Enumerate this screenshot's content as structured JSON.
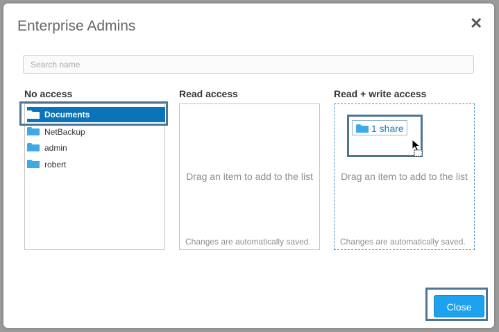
{
  "dialog": {
    "title": "Enterprise Admins",
    "close_icon": "close-icon"
  },
  "search": {
    "placeholder": "Search name",
    "value": ""
  },
  "columns": [
    {
      "title": "No access",
      "items": [
        {
          "label": "Documents",
          "icon": "folder-icon",
          "selected": true
        },
        {
          "label": "NetBackup",
          "icon": "folder-icon",
          "selected": false
        },
        {
          "label": "admin",
          "icon": "folder-icon",
          "selected": false
        },
        {
          "label": "robert",
          "icon": "folder-icon",
          "selected": false
        }
      ]
    },
    {
      "title": "Read access",
      "hint": "Drag an item to add to the list",
      "saved_note": "Changes are automatically saved."
    },
    {
      "title": "Read + write access",
      "hint": "Drag an item to add to the list",
      "saved_note": "Changes are automatically saved.",
      "drag_chip": {
        "label": "1 share",
        "icon": "folder-icon"
      }
    }
  ],
  "footer": {
    "close_label": "Close"
  },
  "colors": {
    "accent": "#1ea1ee",
    "selected_row": "#0b73ba",
    "folder": "#3fa9e6",
    "highlight_border": "#4e7591"
  }
}
